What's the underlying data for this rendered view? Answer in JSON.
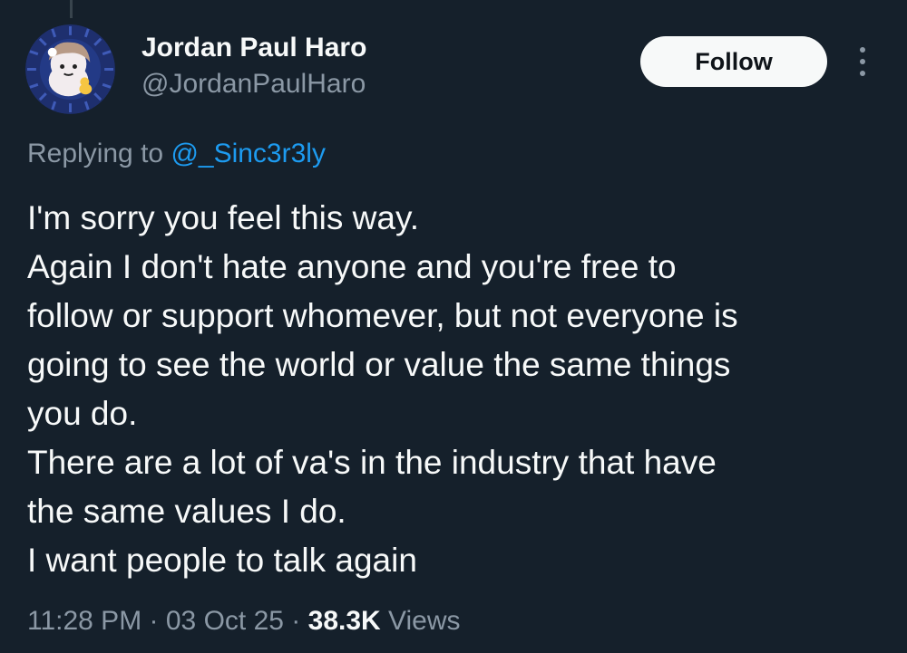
{
  "tweet": {
    "author": {
      "display_name": "Jordan Paul Haro",
      "handle": "@JordanPaulHaro",
      "avatar_icon": "avatar-character-icon"
    },
    "follow_label": "Follow",
    "more_icon": "more-vertical-icon",
    "replying_prefix": "Replying to",
    "replying_to": "@_Sinc3r3ly",
    "lines": [
      "I'm sorry you feel this way.",
      "Again I don't hate anyone and you're free to",
      "follow or support whomever, but not everyone is",
      "going to see the world or value the same things",
      "you do.",
      "There are a lot of va's in the industry that have",
      "the same values I do.",
      "I want people to talk again"
    ],
    "time": "11:28 PM",
    "date": "03 Oct 25",
    "separator": "·",
    "views_count": "38.3K",
    "views_label": "Views"
  },
  "colors": {
    "background": "#15202b",
    "text_primary": "#f7f9f9",
    "text_secondary": "#8b98a5",
    "link": "#1d9bf0",
    "follow_bg": "#f7f9f9",
    "follow_text": "#0f1419"
  }
}
